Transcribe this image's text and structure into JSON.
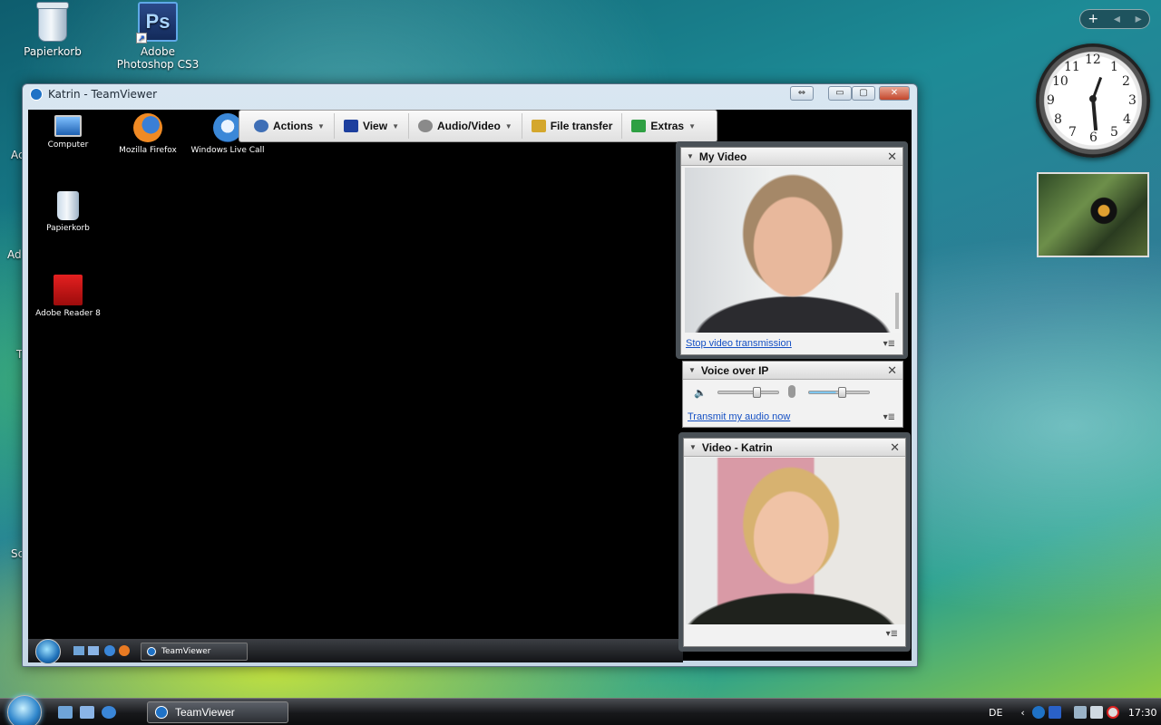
{
  "desktop": {
    "icons": [
      {
        "label": "Papierkorb"
      },
      {
        "label": "Adobe Photoshop CS3",
        "badge": "Ps"
      }
    ],
    "edge_labels": [
      "Ac",
      "Ad",
      "T",
      "Sc"
    ]
  },
  "gadgets": {
    "sidebar_controls": [
      "+",
      "◂",
      "▸"
    ],
    "clock_numbers": [
      "12",
      "1",
      "2",
      "3",
      "4",
      "5",
      "6",
      "7",
      "8",
      "9",
      "10",
      "11"
    ]
  },
  "window": {
    "title": "Katrin - TeamViewer",
    "controls": [
      "⇔",
      "▭",
      "▢",
      "✕"
    ]
  },
  "remote": {
    "icons": [
      {
        "label": "Computer"
      },
      {
        "label": "Mozilla Firefox"
      },
      {
        "label": "Windows Live Call"
      },
      {
        "label": "Papierkorb"
      },
      {
        "label": "Adobe Reader 8"
      }
    ],
    "taskbar_item": "TeamViewer"
  },
  "toolbar": {
    "items": [
      {
        "label": "Actions",
        "icon": "gear-icon",
        "color": "#3f6fb6"
      },
      {
        "label": "View",
        "icon": "monitor-icon",
        "color": "#1d3f9e"
      },
      {
        "label": "Audio/Video",
        "icon": "webcam-icon",
        "color": "#8a8a8a"
      },
      {
        "label": "File transfer",
        "icon": "folder-transfer-icon",
        "color": "#d4a72c"
      },
      {
        "label": "Extras",
        "icon": "puzzle-icon",
        "color": "#2ea043"
      }
    ]
  },
  "panels": {
    "my_video": {
      "title": "My Video",
      "link": "Stop video transmission"
    },
    "voip": {
      "title": "Voice over IP",
      "link": "Transmit my audio now",
      "speaker_level": 0.65,
      "mic_level": 0.55
    },
    "remote_video": {
      "title": "Video - Katrin"
    }
  },
  "taskbar": {
    "task_label": "TeamViewer",
    "language": "DE",
    "time": "17:30"
  }
}
